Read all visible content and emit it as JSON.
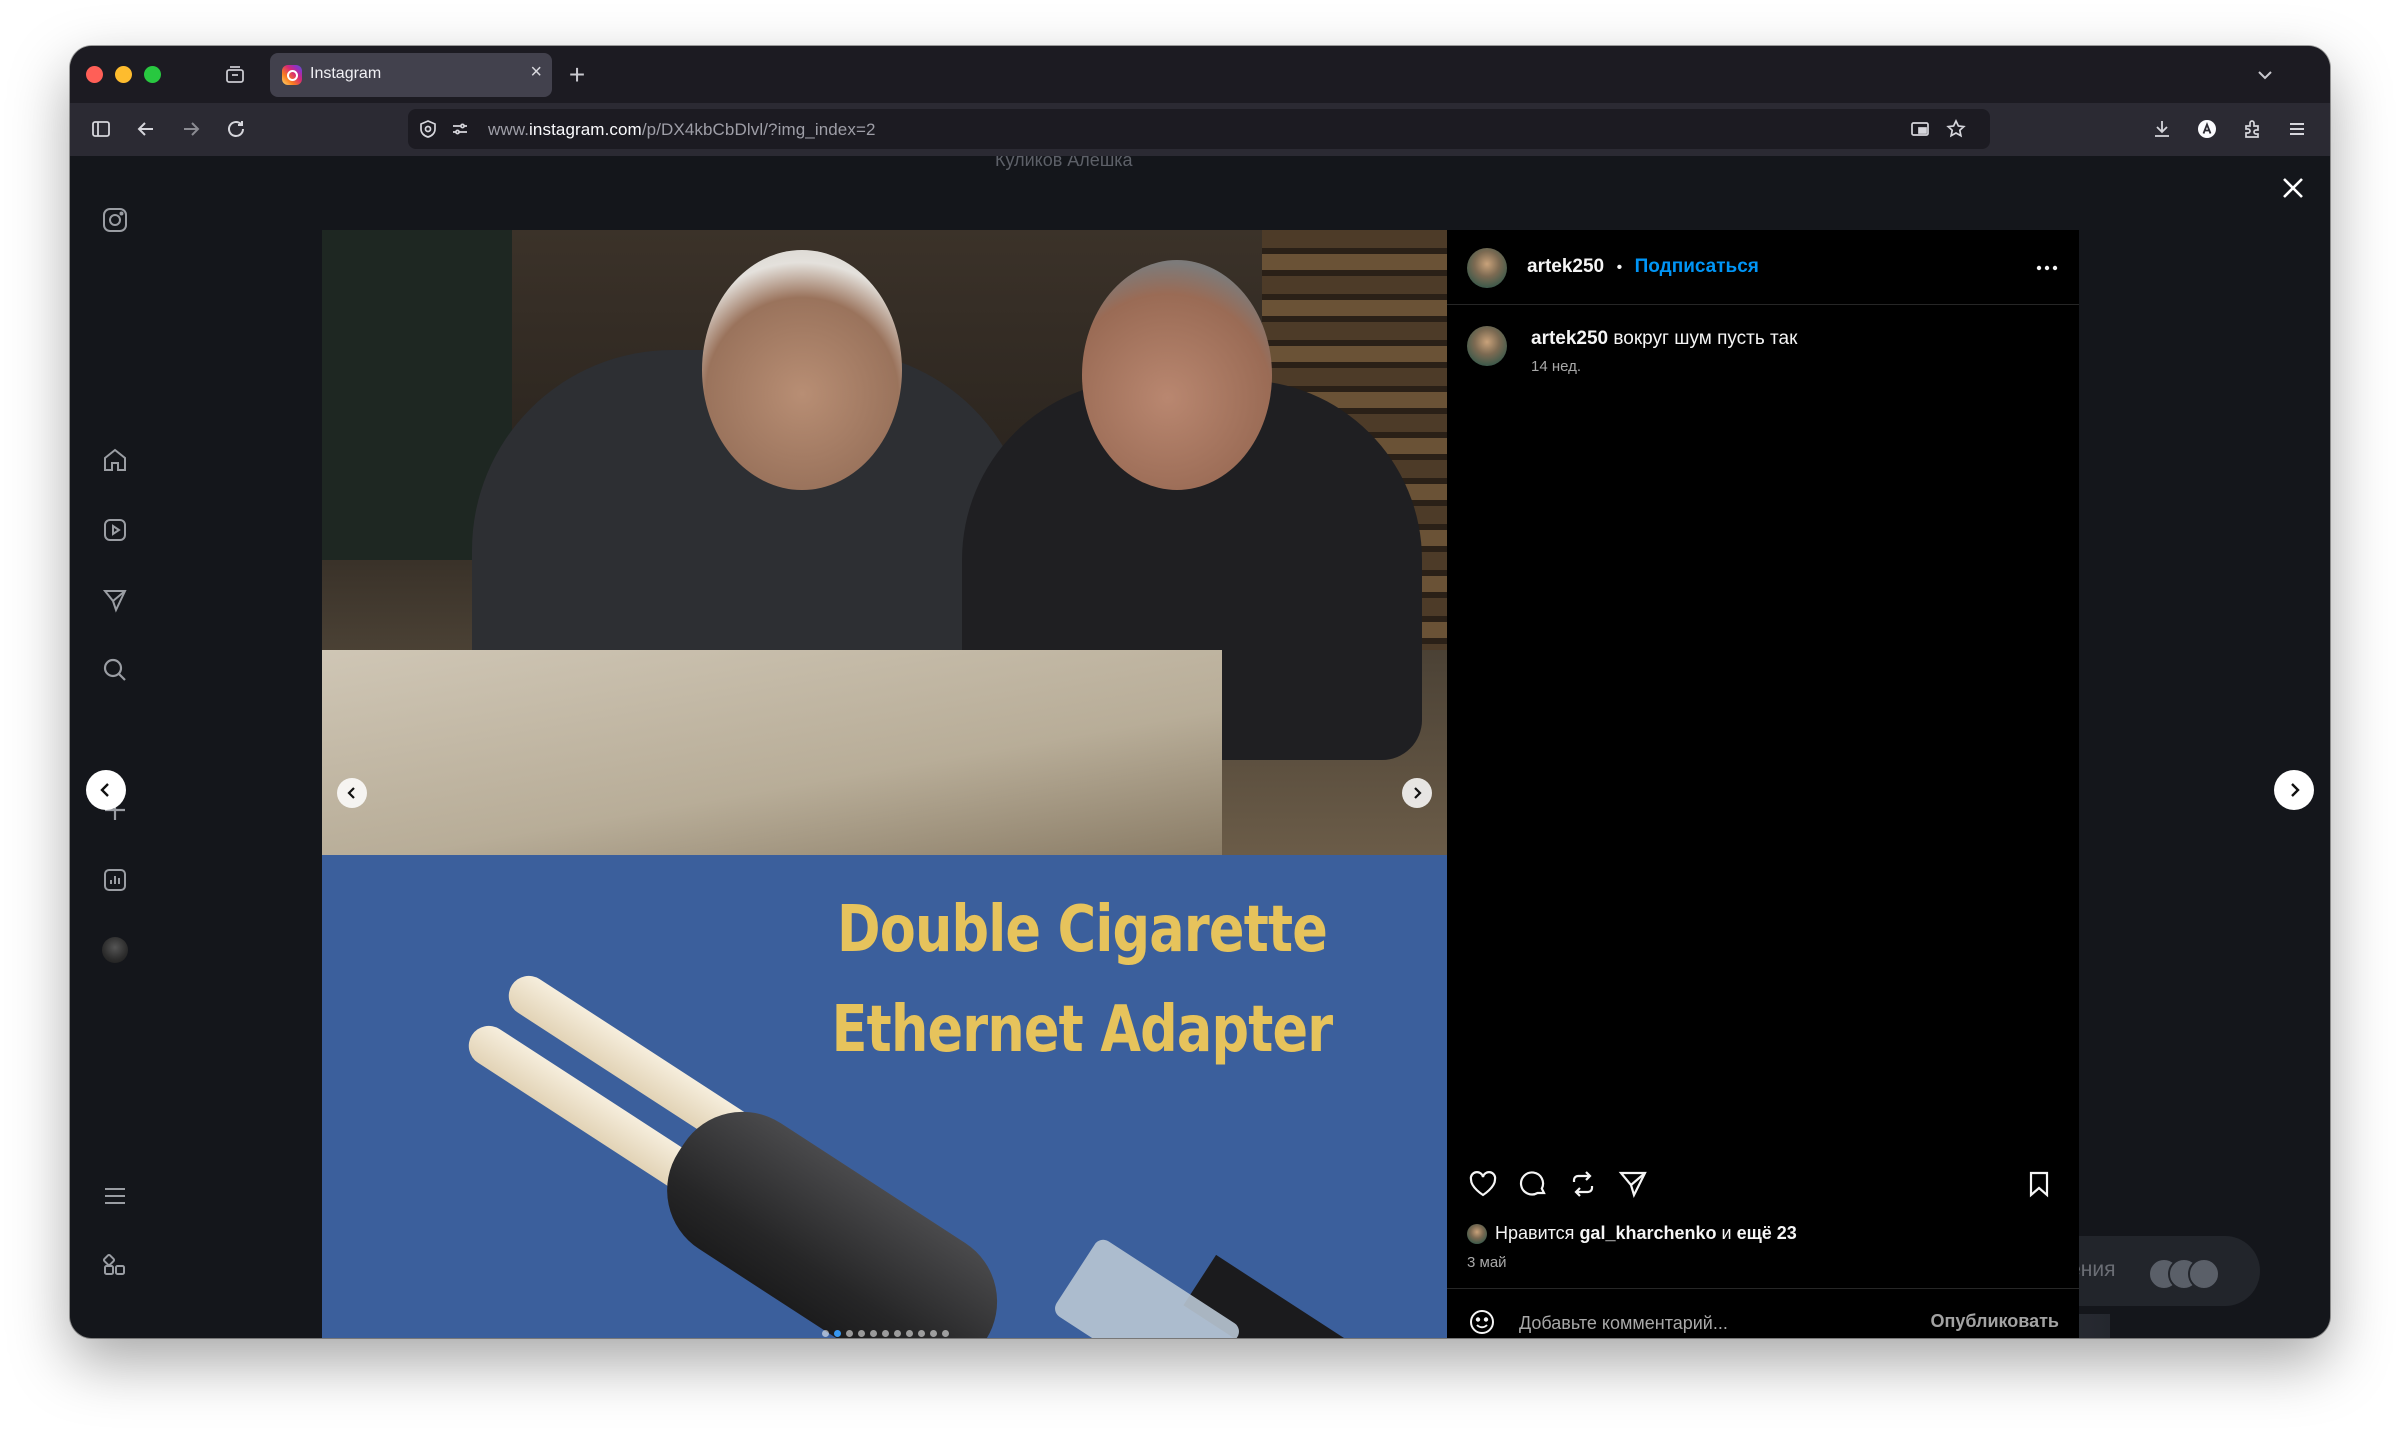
{
  "browser": {
    "tab": {
      "title": "Instagram"
    },
    "url": {
      "prefix": "www.",
      "domain": "instagram.com",
      "path": "/p/DX4kbCbDlvl/?img_index=2"
    }
  },
  "background": {
    "profile_name": "Куликов Алешка",
    "messages_label": "бщения"
  },
  "post": {
    "media": {
      "slide_title_line1": "Double Cigarette",
      "slide_title_line2": "Ethernet Adapter",
      "carousel": {
        "total": 11,
        "active_index": 1
      }
    },
    "author": {
      "username": "artek250",
      "separator": "•",
      "follow_label": "Подписаться"
    },
    "caption": {
      "username": "artek250",
      "text": " вокруг шум пусть так",
      "time": "14 нед."
    },
    "likes": {
      "prefix": "Нравится ",
      "user": "gal_kharchenko",
      "suffix": " и ",
      "more": "ещё 23"
    },
    "date": "3 май",
    "comment": {
      "placeholder": "Добавьте комментарий...",
      "publish_label": "Опубликовать"
    }
  },
  "icons": {
    "nav": [
      "instagram-icon",
      "home-icon",
      "reels-icon",
      "direct-icon",
      "search-icon",
      "create-icon",
      "insights-icon",
      "profile-avatar",
      "menu-icon",
      "apps-icon"
    ],
    "actions": [
      "heart-icon",
      "comment-icon",
      "repost-icon",
      "share-icon",
      "bookmark-icon"
    ]
  },
  "colors": {
    "accent_blue": "#0095f6",
    "slide_bg": "#3b5f9c",
    "slide_text": "#e6c35c"
  }
}
